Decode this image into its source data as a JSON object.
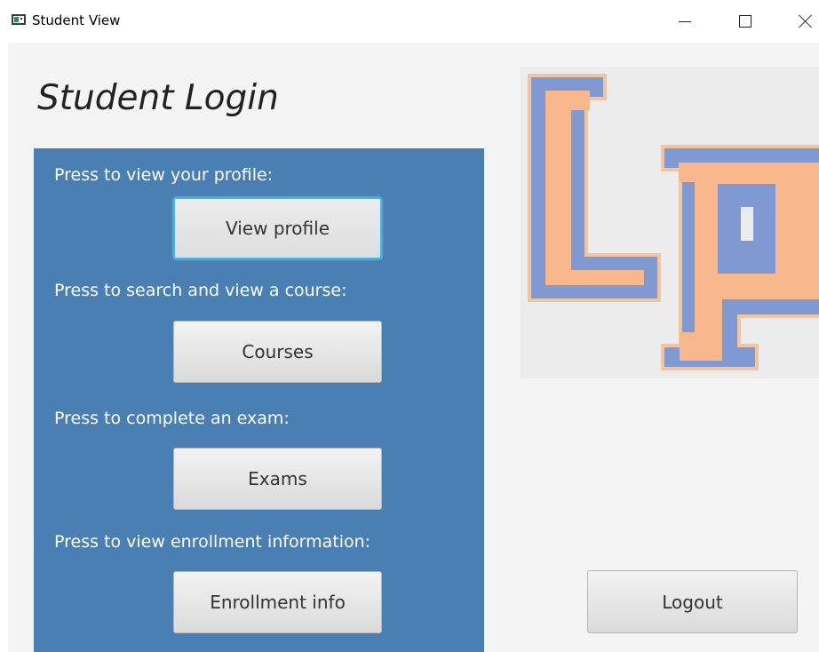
{
  "window": {
    "title": "Student View"
  },
  "page": {
    "heading": "Student Login"
  },
  "panel": {
    "color": "#4a7fb3",
    "items": [
      {
        "prompt": "Press to view your profile:",
        "button": "View profile"
      },
      {
        "prompt": "Press to search and view a course:",
        "button": "Courses"
      },
      {
        "prompt": "Press to complete an exam:",
        "button": "Exams"
      },
      {
        "prompt": "Press to view enrollment information:",
        "button": "Enrollment info"
      }
    ]
  },
  "logo": {
    "fill_color": "#f8b88b",
    "outline_color": "#7f9ad2"
  },
  "logout": {
    "label": "Logout"
  }
}
